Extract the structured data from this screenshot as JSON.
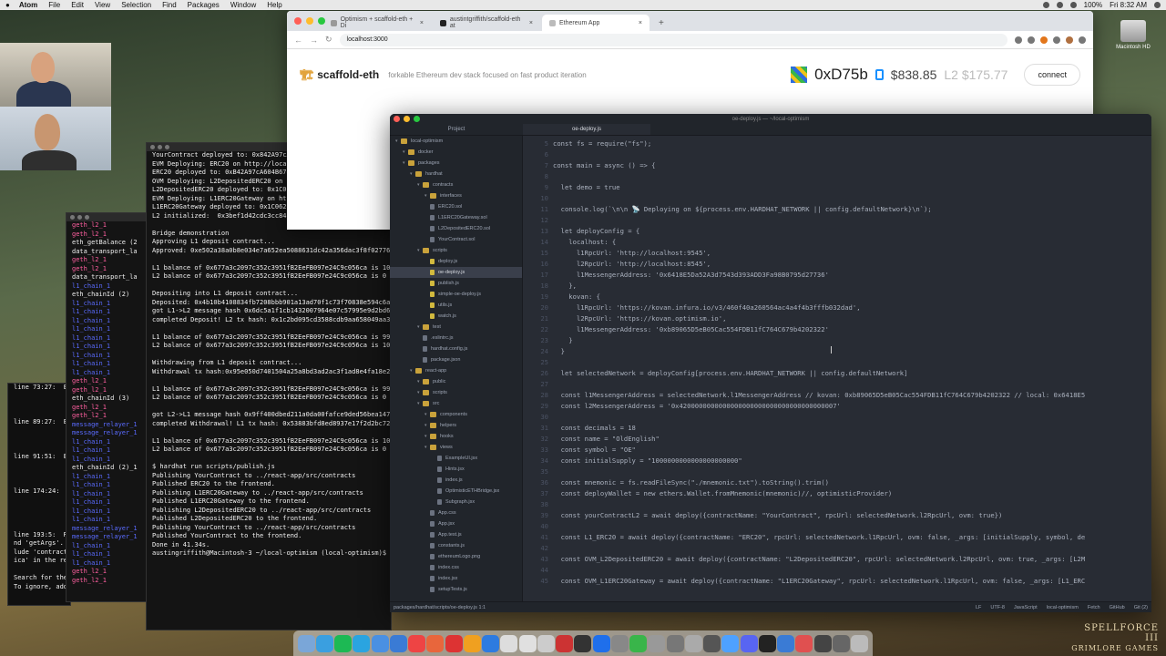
{
  "menubar": {
    "app": "Atom",
    "items": [
      "File",
      "Edit",
      "View",
      "Selection",
      "Find",
      "Packages",
      "Window",
      "Help"
    ],
    "battery": "100%",
    "time": "Fri 8:32 AM"
  },
  "desktop": {
    "drive_label": "Macintosh HD",
    "game_title_1": "SPELLFORCE III",
    "game_title_2": "GRIMLORE GAMES"
  },
  "browser": {
    "tabs": [
      {
        "label": "Optimism + scaffold-eth + Di",
        "active": false
      },
      {
        "label": "austintgriffith/scaffold-eth at",
        "active": false
      },
      {
        "label": "Ethereum App",
        "active": true
      }
    ],
    "url": "localhost:3000",
    "app_title": "scaffold-eth",
    "tagline": "forkable Ethereum dev stack focused on fast product iteration",
    "address": "0xD75b",
    "balance": "$838.85",
    "l2_balance": "L2 $175.77",
    "connect_label": "connect"
  },
  "atom": {
    "window_title": "oe-deploy.js — ~/local-optimism",
    "project_tab": "Project",
    "file_tab": "oe-deploy.js",
    "tree": [
      {
        "label": "local-optimism",
        "depth": 0,
        "kind": "root",
        "sel": false
      },
      {
        "label": "docker",
        "depth": 1,
        "kind": "folder",
        "sel": false
      },
      {
        "label": "packages",
        "depth": 1,
        "kind": "folder",
        "sel": false
      },
      {
        "label": "hardhat",
        "depth": 2,
        "kind": "folder",
        "sel": false
      },
      {
        "label": "contracts",
        "depth": 3,
        "kind": "folder",
        "sel": false
      },
      {
        "label": "interfaces",
        "depth": 4,
        "kind": "folder",
        "sel": false
      },
      {
        "label": "ERC20.sol",
        "depth": 4,
        "kind": "file",
        "sel": false
      },
      {
        "label": "L1ERC20Gateway.sol",
        "depth": 4,
        "kind": "file",
        "sel": false
      },
      {
        "label": "L2DepositedERC20.sol",
        "depth": 4,
        "kind": "file",
        "sel": false
      },
      {
        "label": "YourContract.sol",
        "depth": 4,
        "kind": "file",
        "sel": false
      },
      {
        "label": "scripts",
        "depth": 3,
        "kind": "folder",
        "sel": false
      },
      {
        "label": "deploy.js",
        "depth": 4,
        "kind": "js",
        "sel": false
      },
      {
        "label": "oe-deploy.js",
        "depth": 4,
        "kind": "js",
        "sel": true
      },
      {
        "label": "publish.js",
        "depth": 4,
        "kind": "js",
        "sel": false
      },
      {
        "label": "simple-oe-deploy.js",
        "depth": 4,
        "kind": "js",
        "sel": false
      },
      {
        "label": "utils.js",
        "depth": 4,
        "kind": "js",
        "sel": false
      },
      {
        "label": "watch.js",
        "depth": 4,
        "kind": "js",
        "sel": false
      },
      {
        "label": "test",
        "depth": 3,
        "kind": "folder",
        "sel": false
      },
      {
        "label": ".eslintrc.js",
        "depth": 3,
        "kind": "file",
        "sel": false
      },
      {
        "label": "hardhat.config.js",
        "depth": 3,
        "kind": "file",
        "sel": false
      },
      {
        "label": "package.json",
        "depth": 3,
        "kind": "file",
        "sel": false
      },
      {
        "label": "react-app",
        "depth": 2,
        "kind": "folder",
        "sel": false
      },
      {
        "label": "public",
        "depth": 3,
        "kind": "folder",
        "sel": false
      },
      {
        "label": "scripts",
        "depth": 3,
        "kind": "folder",
        "sel": false
      },
      {
        "label": "src",
        "depth": 3,
        "kind": "folder",
        "sel": false
      },
      {
        "label": "components",
        "depth": 4,
        "kind": "folder",
        "sel": false
      },
      {
        "label": "helpers",
        "depth": 4,
        "kind": "folder",
        "sel": false
      },
      {
        "label": "hooks",
        "depth": 4,
        "kind": "folder",
        "sel": false
      },
      {
        "label": "views",
        "depth": 4,
        "kind": "folder",
        "sel": false
      },
      {
        "label": "ExampleUI.jsx",
        "depth": 5,
        "kind": "file",
        "sel": false
      },
      {
        "label": "Hints.jsx",
        "depth": 5,
        "kind": "file",
        "sel": false
      },
      {
        "label": "index.js",
        "depth": 5,
        "kind": "file",
        "sel": false
      },
      {
        "label": "OptimisticETHBridge.jsx",
        "depth": 5,
        "kind": "file",
        "sel": false
      },
      {
        "label": "Subgraph.jsx",
        "depth": 5,
        "kind": "file",
        "sel": false
      },
      {
        "label": "App.css",
        "depth": 4,
        "kind": "file",
        "sel": false
      },
      {
        "label": "App.jsx",
        "depth": 4,
        "kind": "file",
        "sel": false
      },
      {
        "label": "App.test.js",
        "depth": 4,
        "kind": "file",
        "sel": false
      },
      {
        "label": "constants.js",
        "depth": 4,
        "kind": "file",
        "sel": false
      },
      {
        "label": "ethereumLogo.png",
        "depth": 4,
        "kind": "file",
        "sel": false
      },
      {
        "label": "index.css",
        "depth": 4,
        "kind": "file",
        "sel": false
      },
      {
        "label": "index.jsx",
        "depth": 4,
        "kind": "file",
        "sel": false
      },
      {
        "label": "setupTests.js",
        "depth": 4,
        "kind": "file",
        "sel": false
      }
    ],
    "code_lines": [
      {
        "n": "5",
        "t": "const fs = require(\"fs\");"
      },
      {
        "n": "6",
        "t": ""
      },
      {
        "n": "7",
        "t": "const main = async () => {"
      },
      {
        "n": "8",
        "t": ""
      },
      {
        "n": "9",
        "t": "  let demo = true"
      },
      {
        "n": "10",
        "t": ""
      },
      {
        "n": "11",
        "t": "  console.log(`\\n\\n 📡 Deploying on ${process.env.HARDHAT_NETWORK || config.defaultNetwork}\\n`);"
      },
      {
        "n": "12",
        "t": ""
      },
      {
        "n": "13",
        "t": "  let deployConfig = {"
      },
      {
        "n": "14",
        "t": "    localhost: {"
      },
      {
        "n": "15",
        "t": "      l1RpcUrl: 'http://localhost:9545',"
      },
      {
        "n": "16",
        "t": "      l2RpcUrl: 'http://localhost:8545',"
      },
      {
        "n": "17",
        "t": "      l1MessengerAddress: '0x6418E5Da52A3d7543d393ADD3Fa98B0795d27736'"
      },
      {
        "n": "18",
        "t": "    },"
      },
      {
        "n": "19",
        "t": "    kovan: {"
      },
      {
        "n": "20",
        "t": "      l1RpcUrl: 'https://kovan.infura.io/v3/460f40a260564ac4a4f4b3fffb032dad',"
      },
      {
        "n": "21",
        "t": "      l2RpcUrl: 'https://kovan.optimism.io',"
      },
      {
        "n": "22",
        "t": "      l1MessengerAddress: '0xb89065D5eB05Cac554FDB11fC764C679b4202322'"
      },
      {
        "n": "23",
        "t": "    }"
      },
      {
        "n": "24",
        "t": "  }"
      },
      {
        "n": "25",
        "t": ""
      },
      {
        "n": "26",
        "t": "  let selectedNetwork = deployConfig[process.env.HARDHAT_NETWORK || config.defaultNetwork]"
      },
      {
        "n": "27",
        "t": ""
      },
      {
        "n": "28",
        "t": "  const l1MessengerAddress = selectedNetwork.l1MessengerAddress // kovan: 0xb89065D5eB05Cac554FDB11fC764C679b4202322 // local: 0x6418E5"
      },
      {
        "n": "29",
        "t": "  const l2MessengerAddress = '0x4200000000000000000000000000000000000007'"
      },
      {
        "n": "30",
        "t": ""
      },
      {
        "n": "31",
        "t": "  const decimals = 18"
      },
      {
        "n": "32",
        "t": "  const name = \"OldEnglish\""
      },
      {
        "n": "33",
        "t": "  const symbol = \"OE\""
      },
      {
        "n": "34",
        "t": "  const initialSupply = \"1000000000000000000000\""
      },
      {
        "n": "35",
        "t": ""
      },
      {
        "n": "36",
        "t": "  const mnemonic = fs.readFileSync(\"./mnemonic.txt\").toString().trim()"
      },
      {
        "n": "37",
        "t": "  const deployWallet = new ethers.Wallet.fromMnemonic(mnemonic)//, optimisticProvider)"
      },
      {
        "n": "38",
        "t": ""
      },
      {
        "n": "39",
        "t": "  const yourContractL2 = await deploy({contractName: \"YourContract\", rpcUrl: selectedNetwork.l2RpcUrl, ovm: true})"
      },
      {
        "n": "40",
        "t": ""
      },
      {
        "n": "41",
        "t": "  const L1_ERC20 = await deploy({contractName: \"ERC20\", rpcUrl: selectedNetwork.l1RpcUrl, ovm: false, _args: [initialSupply, symbol, de"
      },
      {
        "n": "42",
        "t": ""
      },
      {
        "n": "43",
        "t": "  const OVM_L2DepositedERC20 = await deploy({contractName: \"L2DepositedERC20\", rpcUrl: selectedNetwork.l2RpcUrl, ovm: true, _args: [L2M"
      },
      {
        "n": "44",
        "t": ""
      },
      {
        "n": "45",
        "t": "  const OVM_L1ERC20Gateway = await deploy({contractName: \"L1ERC20Gateway\", rpcUrl: selectedNetwork.l1RpcUrl, ovm: false, _args: [L1_ERC"
      }
    ],
    "status_path": "packages/hardhat/scripts/oe-deploy.js  1:1",
    "status_right": [
      "LF",
      "UTF-8",
      "JavaScript",
      "local-optimism",
      "Fetch",
      "GitHub",
      "Git (2)"
    ]
  },
  "terminal_main": {
    "lines": [
      {
        "c": "white",
        "t": "YourContract deployed to: 0x842A97cA604B67d7CBf45EE8f29720"
      },
      {
        "c": "white",
        "t": "EVM Deploying: ERC20 on http://localhost:9545"
      },
      {
        "c": "white",
        "t": "ERC20 deployed to: 0xB42A97cA604B67d7CBf45EE8f29720"
      },
      {
        "c": "white",
        "t": "OVM Deploying: L2DepositedERC20 on http://localhost:8545"
      },
      {
        "c": "white",
        "t": "L2DepositedERC20 deployed to: 0x1C062F36E8597a8Fa7D99"
      },
      {
        "c": "white",
        "t": "EVM Deploying: L1ERC20Gateway on http://localhost:9545"
      },
      {
        "c": "white",
        "t": "L1ERC20Gateway deployed to: 0x1C062F36E8597a8Fa7D99"
      },
      {
        "c": "white",
        "t": "L2 initialized:  0x3bef1d42cdc3cc84e5dd3c3fd4daf2693f0ec7fb6ab6da"
      },
      {
        "c": "white",
        "t": ""
      },
      {
        "c": "white",
        "t": "Bridge demonstration"
      },
      {
        "c": "white",
        "t": "Approving L1 deposit contract..."
      },
      {
        "c": "white",
        "t": "Approved: 0xe502a38a0b8e034e7a652ea5088631dc42a356dac3f8f02776e2"
      },
      {
        "c": "white",
        "t": ""
      },
      {
        "c": "white",
        "t": "L1 balance of 0x677a3c2097c352c3951fB2EeFB097e24C9c056ca is 10000"
      },
      {
        "c": "white",
        "t": "L2 balance of 0x677a3c2097c352c3951fB2EeFB097e24C9c056ca is 0"
      },
      {
        "c": "white",
        "t": ""
      },
      {
        "c": "white",
        "t": "Depositing into L1 deposit contract..."
      },
      {
        "c": "white",
        "t": "Deposited: 0x4b10b4108834fb7208bbb901a13ad70f1c73f70838e594c6a45"
      },
      {
        "c": "white",
        "t": "got L1->L2 message hash 0x6dc5a1f1cb1432007964e07c57995e9d2bd6d1"
      },
      {
        "c": "white",
        "t": "completed Deposit! L2 tx hash: 0x1c2bd095cd3588cdb9aa658049aa3392"
      },
      {
        "c": "white",
        "t": ""
      },
      {
        "c": "white",
        "t": "L1 balance of 0x677a3c2097c352c3951fB2EeFB097e24C9c056ca is 99999"
      },
      {
        "c": "white",
        "t": "L2 balance of 0x677a3c2097c352c3951fB2EeFB097e24C9c056ca is 10"
      },
      {
        "c": "white",
        "t": ""
      },
      {
        "c": "white",
        "t": "Withdrawing from L1 deposit contract..."
      },
      {
        "c": "white",
        "t": "Withdrawal tx hash:0x95e050d7401504a25a8bd3ad2ac3f1ad8e4fa18e2cfa"
      },
      {
        "c": "white",
        "t": ""
      },
      {
        "c": "white",
        "t": "L1 balance of 0x677a3c2097c352c3951fB2EeFB097e24C9c056ca is 99999"
      },
      {
        "c": "white",
        "t": "L2 balance of 0x677a3c2097c352c3951fB2EeFB097e24C9c056ca is 0"
      },
      {
        "c": "white",
        "t": ""
      },
      {
        "c": "white",
        "t": "got L2->L1 message hash 0x9ff400dbed211a0da00fafce9ded56bea147f4c"
      },
      {
        "c": "white",
        "t": "completed Withdrawal! L1 tx hash: 0x53883bfd8ed8937e17f2d2bc72818"
      },
      {
        "c": "white",
        "t": ""
      },
      {
        "c": "white",
        "t": "L1 balance of 0x677a3c2097c352c3951fB2EeFB097e24C9c056ca is 10000"
      },
      {
        "c": "white",
        "t": "L2 balance of 0x677a3c2097c352c3951fB2EeFB097e24C9c056ca is 0"
      },
      {
        "c": "white",
        "t": ""
      },
      {
        "c": "white",
        "t": "$ hardhat run scripts/publish.js"
      },
      {
        "c": "white",
        "t": "Publishing YourContract to ../react-app/src/contracts"
      },
      {
        "c": "white",
        "t": "Published ERC20 to the frontend."
      },
      {
        "c": "white",
        "t": "Publishing L1ERC20Gateway to ../react-app/src/contracts"
      },
      {
        "c": "white",
        "t": "Published L1ERC20Gateway to the frontend."
      },
      {
        "c": "white",
        "t": "Publishing L2DepositedERC20 to ../react-app/src/contracts"
      },
      {
        "c": "white",
        "t": "Published L2DepositedERC20 to the frontend."
      },
      {
        "c": "white",
        "t": "Publishing YourContract to ../react-app/src/contracts"
      },
      {
        "c": "white",
        "t": "Published YourContract to the frontend."
      },
      {
        "c": "white",
        "t": "Done in 41.34s."
      },
      {
        "c": "white",
        "t": "austingriffith@Macintosh-3 ~/local-optimism (local-optimism)$"
      }
    ]
  },
  "terminal_left": {
    "lines": [
      {
        "c": "pink",
        "t": "geth_l2_1"
      },
      {
        "c": "pink",
        "t": "geth_l2_1"
      },
      {
        "c": "white",
        "t": "eth_getBalance (2"
      },
      {
        "c": "white",
        "t": "data_transport_la"
      },
      {
        "c": "pink",
        "t": "geth_l2_1"
      },
      {
        "c": "pink",
        "t": "geth_l2_1"
      },
      {
        "c": "white",
        "t": "data_transport_la"
      },
      {
        "c": "blue",
        "t": "l1_chain_1"
      },
      {
        "c": "white",
        "t": "eth_chainId (2)"
      },
      {
        "c": "blue",
        "t": "l1_chain_1"
      },
      {
        "c": "blue",
        "t": "l1_chain_1"
      },
      {
        "c": "blue",
        "t": "l1_chain_1"
      },
      {
        "c": "blue",
        "t": "l1_chain_1"
      },
      {
        "c": "blue",
        "t": "l1_chain_1"
      },
      {
        "c": "blue",
        "t": "l1_chain_1"
      },
      {
        "c": "blue",
        "t": "l1_chain_1"
      },
      {
        "c": "blue",
        "t": "l1_chain_1"
      },
      {
        "c": "blue",
        "t": "l1_chain_1"
      },
      {
        "c": "pink",
        "t": "geth_l2_1"
      },
      {
        "c": "pink",
        "t": "geth_l2_1"
      },
      {
        "c": "white",
        "t": "eth_chainId (3)"
      },
      {
        "c": "pink",
        "t": "geth_l2_1"
      },
      {
        "c": "pink",
        "t": "geth_l2_1"
      },
      {
        "c": "blue",
        "t": "message_relayer_1"
      },
      {
        "c": "blue",
        "t": "message_relayer_1"
      },
      {
        "c": "blue",
        "t": "l1_chain_1"
      },
      {
        "c": "blue",
        "t": "l1_chain_1"
      },
      {
        "c": "blue",
        "t": "l1_chain_1"
      },
      {
        "c": "white",
        "t": "eth_chainId (2)_1"
      },
      {
        "c": "blue",
        "t": "l1_chain_1"
      },
      {
        "c": "blue",
        "t": "l1_chain_1"
      },
      {
        "c": "blue",
        "t": "l1_chain_1"
      },
      {
        "c": "blue",
        "t": "l1_chain_1"
      },
      {
        "c": "blue",
        "t": "l1_chain_1"
      },
      {
        "c": "blue",
        "t": "l1_chain_1"
      },
      {
        "c": "blue",
        "t": "message_relayer_1"
      },
      {
        "c": "blue",
        "t": "message_relayer_1"
      },
      {
        "c": "blue",
        "t": "l1_chain_1"
      },
      {
        "c": "blue",
        "t": "l1_chain_1"
      },
      {
        "c": "blue",
        "t": "l1_chain_1"
      },
      {
        "c": "pink",
        "t": "geth_l2_1"
      },
      {
        "c": "pink",
        "t": "geth_l2_1"
      }
    ]
  },
  "terminal_far": {
    "lines": [
      {
        "c": "white",
        "t": "line 73:27:  Ex"
      },
      {
        "c": "white",
        "t": ""
      },
      {
        "c": "white",
        "t": ""
      },
      {
        "c": "white",
        "t": ""
      },
      {
        "c": "white",
        "t": "line 89:27:  Ex"
      },
      {
        "c": "white",
        "t": ""
      },
      {
        "c": "white",
        "t": ""
      },
      {
        "c": "white",
        "t": ""
      },
      {
        "c": "white",
        "t": "line 91:51:  Ex"
      },
      {
        "c": "white",
        "t": ""
      },
      {
        "c": "white",
        "t": ""
      },
      {
        "c": "white",
        "t": ""
      },
      {
        "c": "white",
        "t": "line 174:24:  Ex"
      },
      {
        "c": "white",
        "t": ""
      },
      {
        "c": "white",
        "t": ""
      },
      {
        "c": "white",
        "t": ""
      },
      {
        "c": "white",
        "t": ""
      },
      {
        "c": "white",
        "t": "line 193:5:  Re"
      },
      {
        "c": "white",
        "t": "nd 'getArgs'. Eit"
      },
      {
        "c": "white",
        "t": "lude 'contractN"
      },
      {
        "c": "white",
        "t": "ica' in the reduce"
      },
      {
        "c": "white",
        "t": ""
      },
      {
        "c": "white",
        "t": "Search for the ke"
      },
      {
        "c": "white",
        "t": "To ignore, add //"
      }
    ]
  }
}
